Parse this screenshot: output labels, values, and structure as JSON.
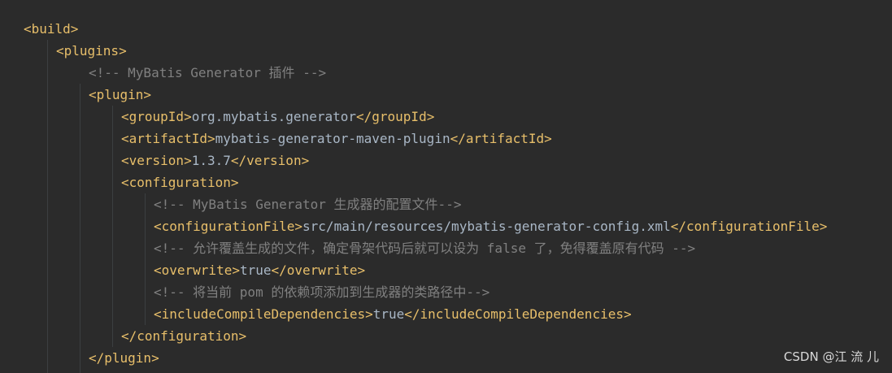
{
  "code": {
    "lines": [
      {
        "indent": 0,
        "segments": [
          {
            "t": "tag",
            "v": "<build>"
          }
        ]
      },
      {
        "indent": 1,
        "segments": [
          {
            "t": "tag",
            "v": "<plugins>"
          }
        ]
      },
      {
        "indent": 2,
        "segments": [
          {
            "t": "comment",
            "v": "<!-- MyBatis Generator 插件 -->"
          }
        ]
      },
      {
        "indent": 2,
        "segments": [
          {
            "t": "tag",
            "v": "<plugin>"
          }
        ]
      },
      {
        "indent": 3,
        "segments": [
          {
            "t": "tag",
            "v": "<groupId>"
          },
          {
            "t": "text",
            "v": "org.mybatis.generator"
          },
          {
            "t": "tag",
            "v": "</groupId>"
          }
        ]
      },
      {
        "indent": 3,
        "segments": [
          {
            "t": "tag",
            "v": "<artifactId>"
          },
          {
            "t": "text",
            "v": "mybatis-generator-maven-plugin"
          },
          {
            "t": "tag",
            "v": "</artifactId>"
          }
        ]
      },
      {
        "indent": 3,
        "segments": [
          {
            "t": "tag",
            "v": "<version>"
          },
          {
            "t": "text",
            "v": "1.3.7"
          },
          {
            "t": "tag",
            "v": "</version>"
          }
        ]
      },
      {
        "indent": 3,
        "segments": [
          {
            "t": "tag",
            "v": "<configuration>"
          }
        ]
      },
      {
        "indent": 4,
        "segments": [
          {
            "t": "comment",
            "v": "<!-- MyBatis Generator 生成器的配置文件-->"
          }
        ]
      },
      {
        "indent": 4,
        "segments": [
          {
            "t": "tag",
            "v": "<configurationFile>"
          },
          {
            "t": "text",
            "v": "src/main/resources/mybatis-generator-config.xml"
          },
          {
            "t": "tag",
            "v": "</configurationFile>"
          }
        ]
      },
      {
        "indent": 4,
        "segments": [
          {
            "t": "comment",
            "v": "<!-- 允许覆盖生成的文件，确定骨架代码后就可以设为 false 了，免得覆盖原有代码 -->"
          }
        ]
      },
      {
        "indent": 4,
        "segments": [
          {
            "t": "tag",
            "v": "<overwrite>"
          },
          {
            "t": "text",
            "v": "true"
          },
          {
            "t": "tag",
            "v": "</overwrite>"
          }
        ]
      },
      {
        "indent": 4,
        "segments": [
          {
            "t": "comment",
            "v": "<!-- 将当前 pom 的依赖项添加到生成器的类路径中-->"
          }
        ]
      },
      {
        "indent": 4,
        "segments": [
          {
            "t": "tag",
            "v": "<includeCompileDependencies>"
          },
          {
            "t": "text",
            "v": "true"
          },
          {
            "t": "tag",
            "v": "</includeCompileDependencies>"
          }
        ]
      },
      {
        "indent": 3,
        "segments": [
          {
            "t": "tag",
            "v": "</configuration>"
          }
        ]
      },
      {
        "indent": 2,
        "segments": [
          {
            "t": "tag",
            "v": "</plugin>"
          }
        ]
      }
    ]
  },
  "watermark": "CSDN @江 流 儿",
  "colors": {
    "background": "#2b2b2b",
    "tag": "#e8bf6a",
    "text": "#a9b7c6",
    "comment": "#808080",
    "indent_guide": "#3c3f41"
  }
}
